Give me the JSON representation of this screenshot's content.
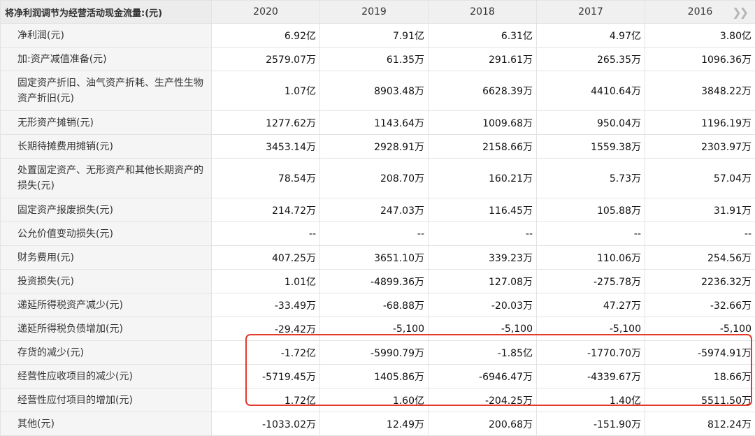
{
  "table": {
    "header_label": "将净利润调节为经营活动现金流量:(元)",
    "years": [
      "2020",
      "2019",
      "2018",
      "2017",
      "2016"
    ],
    "more_icon": "double-chevron-right-icon",
    "rows": [
      {
        "label": "净利润(元)",
        "values": [
          "6.92亿",
          "7.91亿",
          "6.31亿",
          "4.97亿",
          "3.80亿"
        ]
      },
      {
        "label": "加:资产减值准备(元)",
        "values": [
          "2579.07万",
          "61.35万",
          "291.61万",
          "265.35万",
          "1096.36万"
        ]
      },
      {
        "label": "固定资产折旧、油气资产折耗、生产性生物资产折旧(元)",
        "values": [
          "1.07亿",
          "8903.48万",
          "6628.39万",
          "4410.64万",
          "3848.22万"
        ]
      },
      {
        "label": "无形资产摊销(元)",
        "values": [
          "1277.62万",
          "1143.64万",
          "1009.68万",
          "950.04万",
          "1196.19万"
        ]
      },
      {
        "label": "长期待摊费用摊销(元)",
        "values": [
          "3453.14万",
          "2928.91万",
          "2158.66万",
          "1559.38万",
          "2303.97万"
        ]
      },
      {
        "label": "处置固定资产、无形资产和其他长期资产的损失(元)",
        "values": [
          "78.54万",
          "208.70万",
          "160.21万",
          "5.73万",
          "57.04万"
        ]
      },
      {
        "label": "固定资产报废损失(元)",
        "values": [
          "214.72万",
          "247.03万",
          "116.45万",
          "105.88万",
          "31.91万"
        ]
      },
      {
        "label": "公允价值变动损失(元)",
        "values": [
          "--",
          "--",
          "--",
          "--",
          "--"
        ]
      },
      {
        "label": "财务费用(元)",
        "values": [
          "407.25万",
          "3651.10万",
          "339.23万",
          "110.06万",
          "254.56万"
        ]
      },
      {
        "label": "投资损失(元)",
        "values": [
          "1.01亿",
          "-4899.36万",
          "127.08万",
          "-275.78万",
          "2236.32万"
        ]
      },
      {
        "label": "递延所得税资产减少(元)",
        "values": [
          "-33.49万",
          "-68.88万",
          "-20.03万",
          "47.27万",
          "-32.66万"
        ]
      },
      {
        "label": "递延所得税负债增加(元)",
        "values": [
          "-29.42万",
          "-5,100",
          "-5,100",
          "-5,100",
          "-5,100"
        ]
      },
      {
        "label": "存货的减少(元)",
        "values": [
          "-1.72亿",
          "-5990.79万",
          "-1.85亿",
          "-1770.70万",
          "-5974.91万"
        ]
      },
      {
        "label": "经营性应收项目的减少(元)",
        "values": [
          "-5719.45万",
          "1405.86万",
          "-6946.47万",
          "-4339.67万",
          "18.66万"
        ]
      },
      {
        "label": "经营性应付项目的增加(元)",
        "values": [
          "1.72亿",
          "1.60亿",
          "-204.25万",
          "1.40亿",
          "5511.50万"
        ]
      },
      {
        "label": "其他(元)",
        "values": [
          "-1033.02万",
          "12.49万",
          "200.68万",
          "-151.90万",
          "812.24万"
        ]
      }
    ]
  },
  "highlight_color": "#e53a2a"
}
